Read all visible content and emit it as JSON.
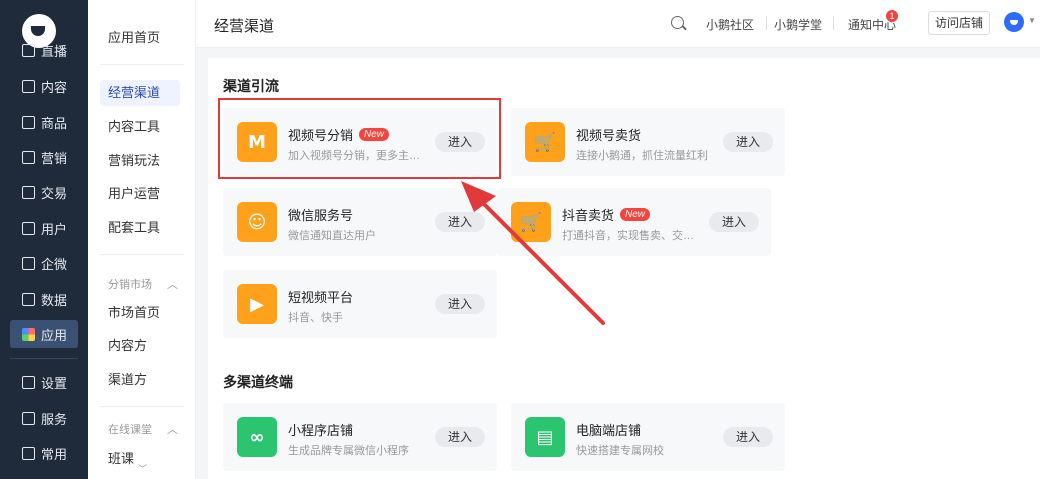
{
  "nav": {
    "items": [
      {
        "label": "直播",
        "icon": "live-icon"
      },
      {
        "label": "内容",
        "icon": "content-icon"
      },
      {
        "label": "商品",
        "icon": "goods-icon"
      },
      {
        "label": "营销",
        "icon": "marketing-icon"
      },
      {
        "label": "交易",
        "icon": "trade-icon"
      },
      {
        "label": "用户",
        "icon": "user-icon"
      },
      {
        "label": "企微",
        "icon": "wecom-icon"
      },
      {
        "label": "数据",
        "icon": "data-icon"
      },
      {
        "label": "应用",
        "icon": "apps-icon"
      },
      {
        "label": "设置",
        "icon": "settings-icon"
      },
      {
        "label": "服务",
        "icon": "service-icon"
      },
      {
        "label": "常用",
        "icon": "common-icon"
      }
    ]
  },
  "subnav": {
    "items": [
      "应用首页",
      "经营渠道",
      "内容工具",
      "营销玩法",
      "用户运营",
      "配套工具"
    ],
    "group1": "分销市场",
    "group1_items": [
      "市场首页",
      "内容方",
      "渠道方"
    ],
    "group2": "在线课堂",
    "group2_items": [
      "班课"
    ]
  },
  "header": {
    "title": "经营渠道",
    "links": [
      "小鹅社区",
      "小鹅学堂",
      "通知中心"
    ],
    "badge": "1",
    "visit_btn": "访问店铺"
  },
  "sections": [
    {
      "title": "渠道引流",
      "cards": [
        {
          "name": "视频号分销",
          "new": "New",
          "desc": "加入视频号分销，更多主播...",
          "btn": "进入",
          "color": "orange",
          "icon": "video-distribution-icon"
        },
        {
          "name": "视频号卖货",
          "desc": "连接小鹅通，抓住流量红利",
          "btn": "进入",
          "color": "orange",
          "icon": "video-shop-icon"
        },
        {
          "name": "微信服务号",
          "desc": "微信通知直达用户",
          "btn": "进入",
          "color": "orange",
          "icon": "wechat-service-icon"
        },
        {
          "name": "抖音卖货",
          "new": "New",
          "desc": "打通抖音，实现售卖、交付...",
          "btn": "进入",
          "color": "orange",
          "icon": "douyin-shop-icon"
        },
        {
          "name": "短视频平台",
          "desc": "抖音、快手",
          "btn": "进入",
          "color": "orange",
          "icon": "short-video-icon"
        }
      ]
    },
    {
      "title": "多渠道终端",
      "cards": [
        {
          "name": "小程序店铺",
          "desc": "生成品牌专属微信小程序",
          "btn": "进入",
          "color": "green",
          "icon": "miniprogram-icon"
        },
        {
          "name": "电脑端店铺",
          "desc": "快速搭建专属网校",
          "btn": "进入",
          "color": "green",
          "icon": "pc-shop-icon"
        }
      ]
    }
  ],
  "colors": {
    "nav_bg": "#1f2a3a",
    "accent_orange": "#ffa11a",
    "accent_green": "#2bc46f",
    "badge_red": "#f5433d",
    "annotation_red": "#e23a3a"
  }
}
